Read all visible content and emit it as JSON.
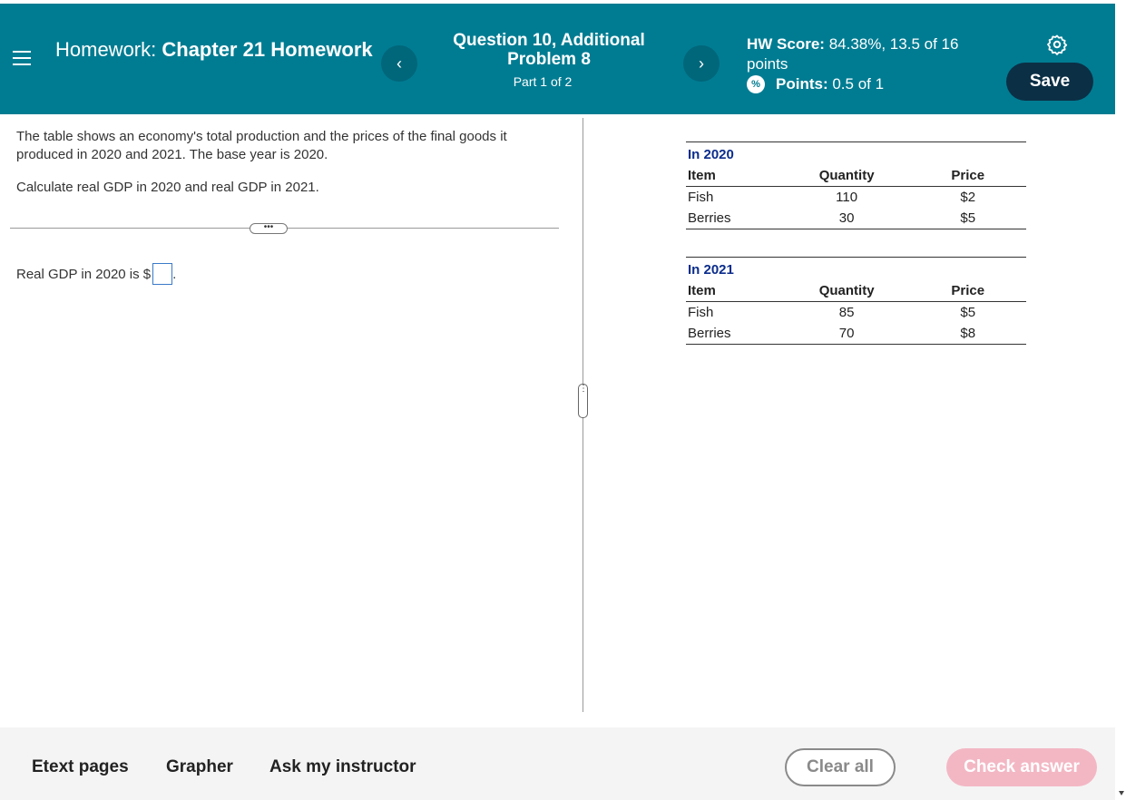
{
  "header": {
    "hw_label": "Homework:",
    "hw_title": "Chapter 21 Homework",
    "prev_label": "‹",
    "next_label": "›",
    "question_title": "Question 10, Additional Problem 8",
    "question_part": "Part 1 of 2",
    "score_label": "HW Score:",
    "score_value": "84.38%, 13.5 of 16 points",
    "points_label": "Points:",
    "points_value": "0.5 of 1",
    "save_label": "Save",
    "colors": {
      "header_bg": "#007c92",
      "save_bg": "#0b2f45"
    }
  },
  "question": {
    "prompt_1": "The table shows an economy's total production and the prices of the final goods it produced in 2020 and 2021. The base year is 2020.",
    "prompt_2": "Calculate real GDP in 2020 and real GDP in 2021.",
    "dots_label": "•••",
    "answer_prefix": "Real GDP in 2020 is $",
    "answer_suffix": ".",
    "answer_value": ""
  },
  "tables": [
    {
      "caption": "In 2020",
      "headers": [
        "Item",
        "Quantity",
        "Price"
      ],
      "rows": [
        [
          "Fish",
          "110",
          "$2"
        ],
        [
          "Berries",
          "30",
          "$5"
        ]
      ]
    },
    {
      "caption": "In 2021",
      "headers": [
        "Item",
        "Quantity",
        "Price"
      ],
      "rows": [
        [
          "Fish",
          "85",
          "$5"
        ],
        [
          "Berries",
          "70",
          "$8"
        ]
      ]
    }
  ],
  "splitter_label": "⋮",
  "footer": {
    "etext_label": "Etext pages",
    "grapher_label": "Grapher",
    "ask_label": "Ask my instructor",
    "clear_label": "Clear all",
    "check_label": "Check answer"
  },
  "icons": [
    "menu-icon",
    "chevron-left-icon",
    "chevron-right-icon",
    "partial-score-icon",
    "gear-icon"
  ]
}
